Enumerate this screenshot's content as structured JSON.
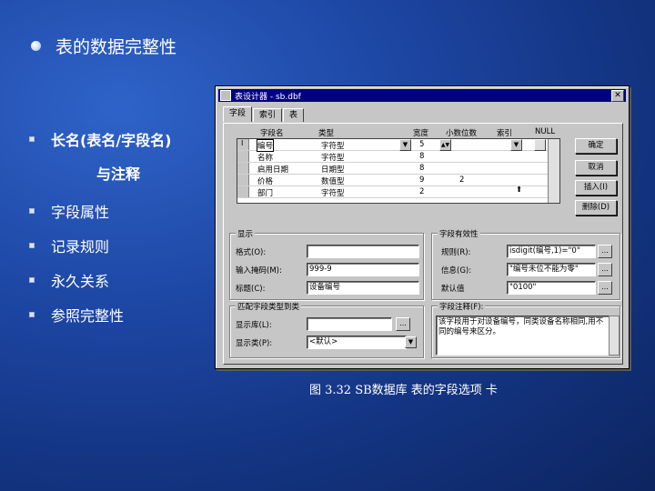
{
  "slide": {
    "title": "表的数据完整性",
    "bullets": [
      "长名(表名/字段名)",
      "字段属性",
      "记录规则",
      "永久关系",
      "参照完整性"
    ],
    "bullet_sub": "与注释",
    "caption": "图  3.32  SB数据库 表的字段选项 卡"
  },
  "dialog": {
    "title": "表设计器 - sb.dbf",
    "tabs": [
      "字段",
      "索引",
      "表"
    ],
    "columns": [
      "字段名",
      "类型",
      "宽度",
      "小数位数",
      "索引",
      "NULL"
    ],
    "rows": [
      {
        "name": "编号",
        "type": "字符型",
        "width": "5",
        "dec": ""
      },
      {
        "name": "名称",
        "type": "字符型",
        "width": "8",
        "dec": ""
      },
      {
        "name": "启用日期",
        "type": "日期型",
        "width": "8",
        "dec": ""
      },
      {
        "name": "价格",
        "type": "数值型",
        "width": "9",
        "dec": "2"
      },
      {
        "name": "部门",
        "type": "字符型",
        "width": "2",
        "dec": ""
      }
    ],
    "buttons": {
      "ok": "确定",
      "cancel": "取消",
      "insert": "插入(I)",
      "delete": "删除(D)"
    },
    "display": {
      "group": "显示",
      "format_label": "格式(O):",
      "format_value": "",
      "mask_label": "输入掩码(M):",
      "mask_value": "999-9",
      "caption_label": "标题(C):",
      "caption_value": "设备编号"
    },
    "validation": {
      "group": "字段有效性",
      "rule_label": "规则(R):",
      "rule_value": "isdigit(编号,1)=\"0\"",
      "message_label": "信息(G):",
      "message_value": "\"编号未位不能为零\"",
      "default_label": "默认值",
      "default_value": "\"0100\""
    },
    "mapping": {
      "group": "匹配字段类型到类",
      "library_label": "显示库(L):",
      "library_value": "",
      "class_label": "显示类(P):",
      "class_value": "<默认>"
    },
    "comment": {
      "group": "字段注释(F):",
      "text": "该字段用于对设备编号，同类设备名称相同,用不同的编号来区分。"
    }
  }
}
